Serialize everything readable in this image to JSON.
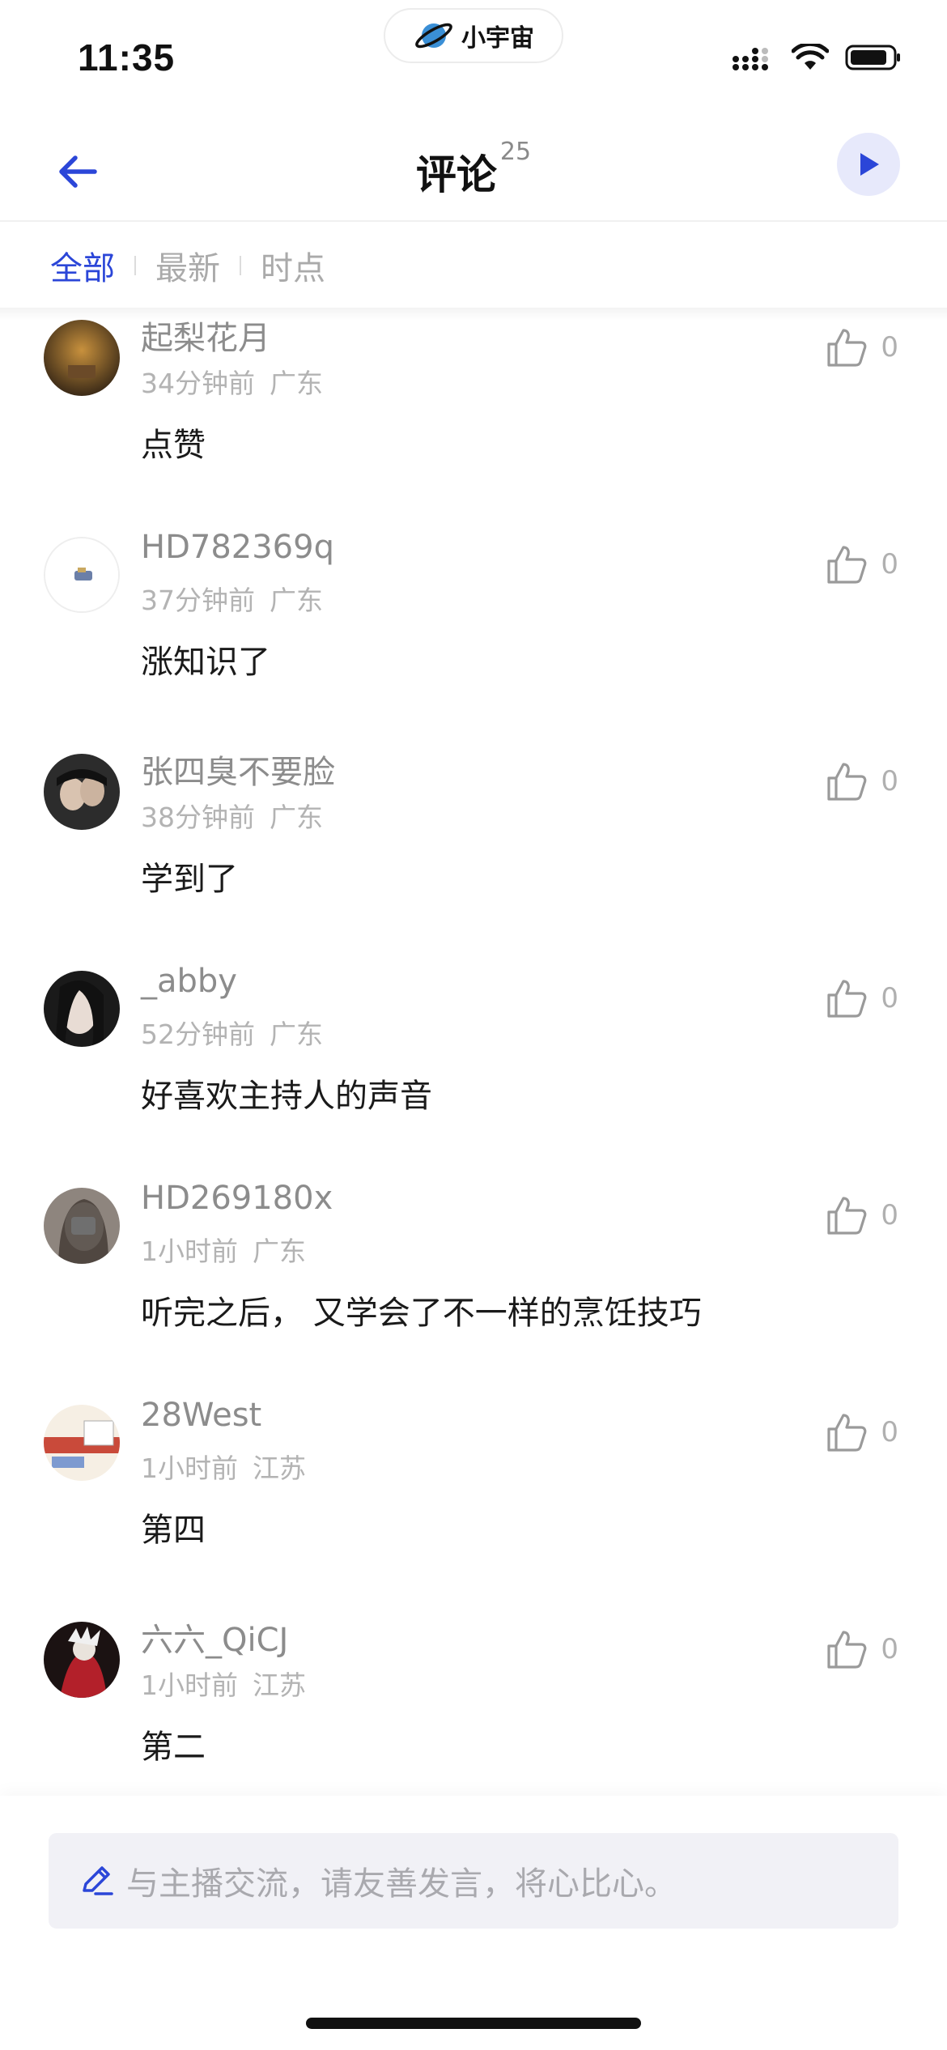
{
  "status_bar": {
    "time": "11:35",
    "app_name": "小宇宙"
  },
  "nav": {
    "title": "评论",
    "count": "25",
    "back_icon": "back-arrow-icon",
    "play_icon": "play-icon"
  },
  "tabs": [
    {
      "label": "全部",
      "active": true
    },
    {
      "label": "最新",
      "active": false
    },
    {
      "label": "时点",
      "active": false
    }
  ],
  "comments": [
    {
      "name": "起梨花月",
      "time": "34分钟前",
      "region": "广东",
      "text": "点赞",
      "likes": "0"
    },
    {
      "name": "HD782369q",
      "time": "37分钟前",
      "region": "广东",
      "text": "涨知识了",
      "likes": "0"
    },
    {
      "name": "张四臭不要脸",
      "time": "38分钟前",
      "region": "广东",
      "text": "学到了",
      "likes": "0"
    },
    {
      "name": "_abby",
      "time": "52分钟前",
      "region": "广东",
      "text": "好喜欢主持人的声音",
      "likes": "0"
    },
    {
      "name": "HD269180x",
      "time": "1小时前",
      "region": "广东",
      "text": "听完之后， 又学会了不一样的烹饪技巧",
      "likes": "0"
    },
    {
      "name": "28West",
      "time": "1小时前",
      "region": "江苏",
      "text": "第四",
      "likes": "0"
    },
    {
      "name": "六六_QiCJ",
      "time": "1小时前",
      "region": "江苏",
      "text": "第二",
      "likes": "0"
    }
  ],
  "input": {
    "placeholder": "与主播交流，请友善发言，将心比心。"
  },
  "colors": {
    "accent": "#2b46d8",
    "play_bg": "#e7e9fb"
  }
}
